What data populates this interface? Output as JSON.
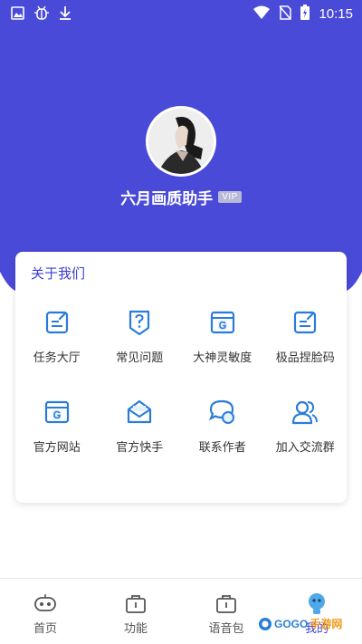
{
  "colors": {
    "header_bg": "#4a4ad8",
    "accent": "#3c3fd6",
    "icon_blue": "#2b7cd9"
  },
  "statusbar": {
    "time": "10:15",
    "left_icons": [
      "image-icon",
      "bug-icon",
      "download-icon"
    ],
    "right_icons": [
      "wifi-icon",
      "no-sim-icon",
      "battery-charging-icon"
    ]
  },
  "profile": {
    "name": "六月画质助手",
    "badge": "VIP"
  },
  "about": {
    "title": "关于我们",
    "items": [
      {
        "label": "任务大厅",
        "icon": "edit-note-icon"
      },
      {
        "label": "常见问题",
        "icon": "question-shield-icon"
      },
      {
        "label": "大神灵敏度",
        "icon": "browser-g-icon"
      },
      {
        "label": "极品捏脸码",
        "icon": "edit-note-icon"
      },
      {
        "label": "官方网站",
        "icon": "browser-g-icon"
      },
      {
        "label": "官方快手",
        "icon": "mail-box-icon"
      },
      {
        "label": "联系作者",
        "icon": "chat-bubbles-icon"
      },
      {
        "label": "加入交流群",
        "icon": "group-icon"
      }
    ]
  },
  "nav": {
    "items": [
      {
        "label": "首页",
        "icon": "gamepad-icon",
        "active": false
      },
      {
        "label": "功能",
        "icon": "toolbox-icon",
        "active": false
      },
      {
        "label": "语音包",
        "icon": "toolbox-icon",
        "active": false
      },
      {
        "label": "我的",
        "icon": "robot-icon",
        "active": true
      }
    ]
  },
  "watermark": {
    "text": "GOGO",
    "sub": "手游网"
  }
}
